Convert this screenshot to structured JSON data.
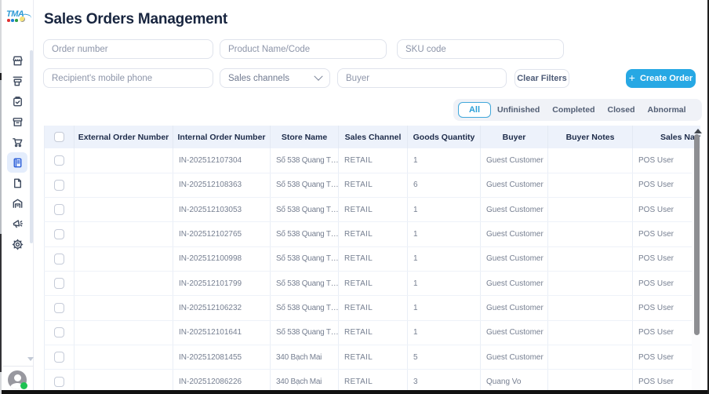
{
  "sidebar": {
    "logo_text": "TMA",
    "logo_dot_colors": [
      "#e03131",
      "#1c7ed6",
      "#2f9e44"
    ],
    "items": [
      {
        "icon": "storefront-icon"
      },
      {
        "icon": "pos-register-icon"
      },
      {
        "icon": "clipboard-check-icon"
      },
      {
        "icon": "archive-box-icon"
      },
      {
        "icon": "shopping-cart-icon"
      },
      {
        "icon": "order-book-icon",
        "active": true
      },
      {
        "icon": "document-icon"
      },
      {
        "icon": "warehouse-icon"
      },
      {
        "icon": "megaphone-icon"
      },
      {
        "icon": "gear-icon"
      }
    ],
    "active_index": 5,
    "avatar_status_color": "#1ec252"
  },
  "header": {
    "title": "Sales Orders Management"
  },
  "filters": {
    "order_number": {
      "placeholder": "Order number",
      "value": ""
    },
    "product": {
      "placeholder": "Product Name/Code",
      "value": ""
    },
    "sku": {
      "placeholder": "SKU code",
      "value": ""
    },
    "phone": {
      "placeholder": "Recipient's mobile phone",
      "value": ""
    },
    "sales_channels": {
      "label": "Sales channels"
    },
    "buyer": {
      "placeholder": "Buyer",
      "value": ""
    },
    "clear_label": "Clear Filters",
    "create_label": "Create Order",
    "create_plus": "+"
  },
  "tabs": {
    "items": [
      "All",
      "Unfinished",
      "Completed",
      "Closed",
      "Abnormal"
    ],
    "active": "All"
  },
  "table": {
    "columns": [
      "",
      "External Order Number",
      "Internal Order Number",
      "Store Name",
      "Sales Channel",
      "Goods Quantity",
      "Buyer",
      "Buyer Notes",
      "Sales Name"
    ],
    "rows": [
      {
        "external": "",
        "internal": "IN-202512107304",
        "store": "Số 538 Quang T…",
        "channel": "RETAIL",
        "qty": "1",
        "buyer": "Guest Customer",
        "notes": "",
        "sales_name": "POS User"
      },
      {
        "external": "",
        "internal": "IN-202512108363",
        "store": "Số 538 Quang T…",
        "channel": "RETAIL",
        "qty": "6",
        "buyer": "Guest Customer",
        "notes": "",
        "sales_name": "POS User"
      },
      {
        "external": "",
        "internal": "IN-202512103053",
        "store": "Số 538 Quang T…",
        "channel": "RETAIL",
        "qty": "1",
        "buyer": "Guest Customer",
        "notes": "",
        "sales_name": "POS User"
      },
      {
        "external": "",
        "internal": "IN-202512102765",
        "store": "Số 538 Quang T…",
        "channel": "RETAIL",
        "qty": "1",
        "buyer": "Guest Customer",
        "notes": "",
        "sales_name": "POS User"
      },
      {
        "external": "",
        "internal": "IN-202512100998",
        "store": "Số 538 Quang T…",
        "channel": "RETAIL",
        "qty": "1",
        "buyer": "Guest Customer",
        "notes": "",
        "sales_name": "POS User"
      },
      {
        "external": "",
        "internal": "IN-202512101799",
        "store": "Số 538 Quang T…",
        "channel": "RETAIL",
        "qty": "1",
        "buyer": "Guest Customer",
        "notes": "",
        "sales_name": "POS User"
      },
      {
        "external": "",
        "internal": "IN-202512106232",
        "store": "Số 538 Quang T…",
        "channel": "RETAIL",
        "qty": "1",
        "buyer": "Guest Customer",
        "notes": "",
        "sales_name": "POS User"
      },
      {
        "external": "",
        "internal": "IN-202512101641",
        "store": "Số 538 Quang T…",
        "channel": "RETAIL",
        "qty": "1",
        "buyer": "Guest Customer",
        "notes": "",
        "sales_name": "POS User"
      },
      {
        "external": "",
        "internal": "IN-202512081455",
        "store": "340 Bạch Mai",
        "channel": "RETAIL",
        "qty": "5",
        "buyer": "Guest Customer",
        "notes": "",
        "sales_name": "POS User"
      },
      {
        "external": "",
        "internal": "IN-202512086226",
        "store": "340 Bạch Mai",
        "channel": "RETAIL",
        "qty": "3",
        "buyer": "Quang Vo",
        "notes": "",
        "sales_name": "POS User"
      }
    ]
  },
  "colors": {
    "accent_blue": "#27a8e4",
    "active_nav_blue": "#2c5fd8",
    "header_bg": "#edf2fb",
    "title_navy": "#18253f",
    "status_green": "#1ec252"
  }
}
